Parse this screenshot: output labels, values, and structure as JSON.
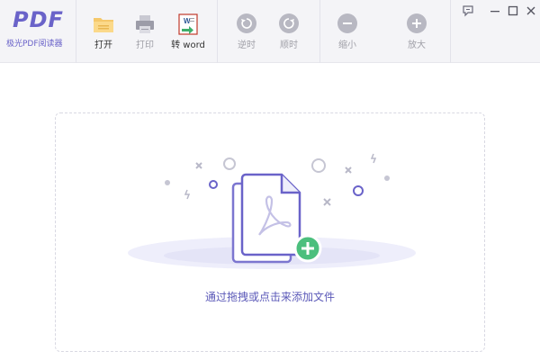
{
  "app": {
    "logo_text": "PDF",
    "name": "极光PDF阅读器"
  },
  "toolbar": {
    "open_label": "打开",
    "print_label": "打印",
    "to_word_label": "转 word",
    "rotate_ccw_label": "逆时",
    "rotate_cw_label": "顺时",
    "zoom_out_label": "缩小",
    "zoom_in_label": "放大"
  },
  "dropzone": {
    "hint": "通过拖拽或点击来添加文件"
  },
  "colors": {
    "brand": "#6a63c9",
    "hint": "#5b59b8",
    "add_badge": "#4bbf7d",
    "toolbar_bg": "#f4f4f7"
  }
}
